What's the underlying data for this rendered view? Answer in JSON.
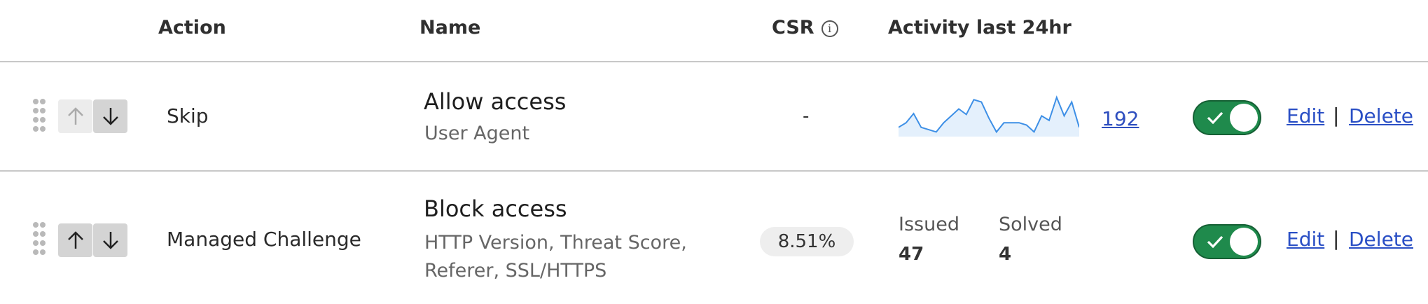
{
  "columns": {
    "action": "Action",
    "name": "Name",
    "csr": "CSR",
    "activity": "Activity last 24hr"
  },
  "colors": {
    "toggle_on": "#1f8a4c",
    "link": "#2a4fc5",
    "sparkline": "#3d8fe6",
    "sparkline_fill": "#e4f0fc"
  },
  "rows": [
    {
      "action": "Skip",
      "name": "Allow access",
      "fields": "User Agent",
      "csr": "-",
      "activity_count": "192",
      "sparkline": [
        2,
        3,
        5,
        2,
        1.5,
        1,
        3,
        4.5,
        6,
        4.8,
        8,
        7.5,
        4,
        1,
        3,
        3,
        3,
        2.5,
        1,
        4.5,
        3.5,
        8.5,
        4.5,
        7.5,
        2
      ],
      "move_up_enabled": false,
      "move_down_enabled": true,
      "enabled": true,
      "edit_label": "Edit",
      "delete_label": "Delete",
      "separator": "|"
    },
    {
      "action": "Managed Challenge",
      "name": "Block access",
      "fields": "HTTP Version, Threat Score, Referer, SSL/HTTPS",
      "csr": "8.51%",
      "issued_label": "Issued",
      "issued_value": "47",
      "solved_label": "Solved",
      "solved_value": "4",
      "move_up_enabled": true,
      "move_down_enabled": true,
      "enabled": true,
      "edit_label": "Edit",
      "delete_label": "Delete",
      "separator": "|"
    }
  ]
}
